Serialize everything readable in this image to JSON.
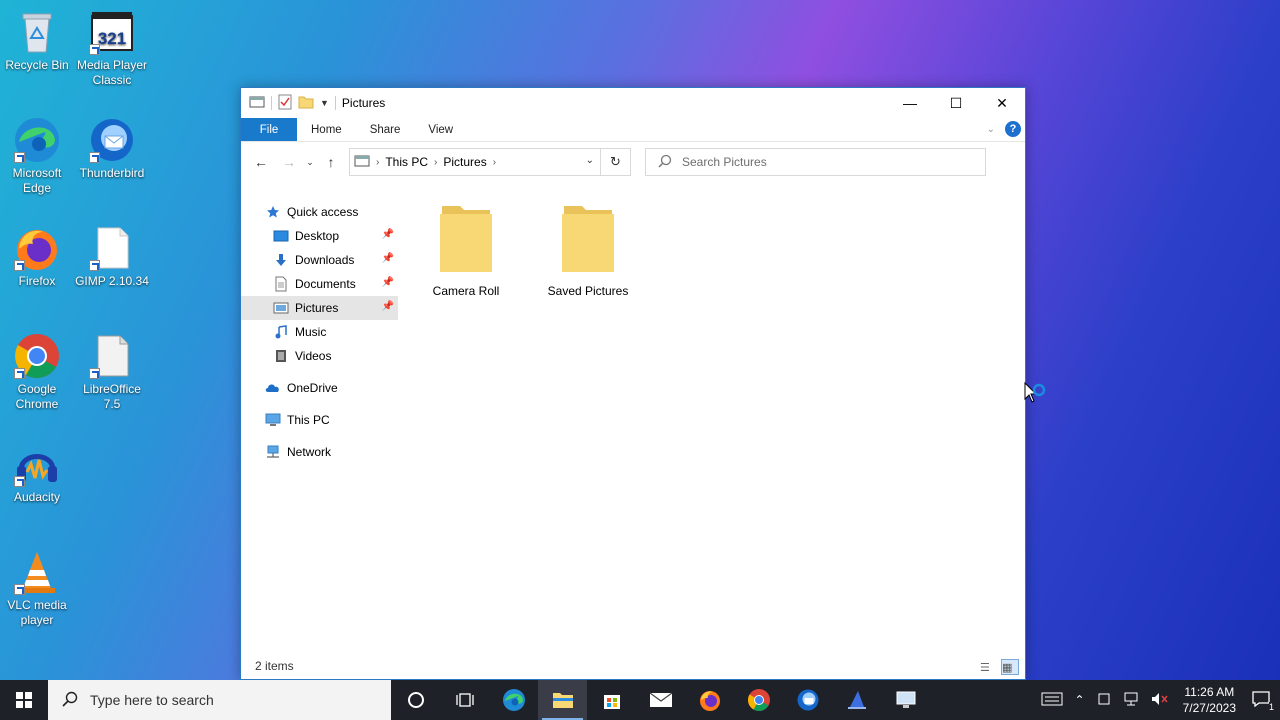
{
  "desktop": {
    "icons": [
      {
        "label": "Recycle Bin"
      },
      {
        "label": "Media Player Classic"
      },
      {
        "label": "Microsoft Edge"
      },
      {
        "label": "Thunderbird"
      },
      {
        "label": "Firefox"
      },
      {
        "label": "GIMP 2.10.34"
      },
      {
        "label": "Google Chrome"
      },
      {
        "label": "LibreOffice 7.5"
      },
      {
        "label": "Audacity"
      },
      {
        "label": "VLC media player"
      }
    ],
    "mpc_badge": "321"
  },
  "window": {
    "title": "Pictures",
    "ribbon_tabs": [
      "File",
      "Home",
      "Share",
      "View"
    ],
    "help_label": "?",
    "address": {
      "crumbs": [
        "This PC",
        "Pictures"
      ]
    },
    "search_placeholder": "Search Pictures",
    "nav": {
      "quick_access": "Quick access",
      "items": [
        "Desktop",
        "Downloads",
        "Documents",
        "Pictures",
        "Music",
        "Videos"
      ],
      "onedrive": "OneDrive",
      "this_pc": "This PC",
      "network": "Network"
    },
    "folders": [
      "Camera Roll",
      "Saved Pictures"
    ],
    "status": "2 items"
  },
  "taskbar": {
    "search_placeholder": "Type here to search",
    "time": "11:26 AM",
    "date": "7/27/2023",
    "notification_count": "1"
  },
  "colors": {
    "accent": "#1979ca",
    "folder": "#f8d775",
    "taskbar": "#1f2128"
  }
}
